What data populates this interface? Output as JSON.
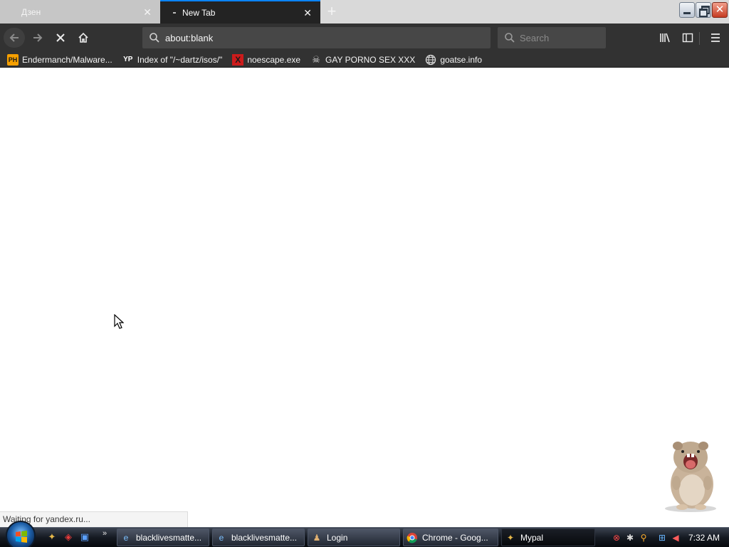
{
  "tabs": [
    {
      "title": "Дзен",
      "close": "✕"
    },
    {
      "title": "New Tab",
      "close": "✕"
    }
  ],
  "newtab_symbol": "+",
  "window_controls": {
    "minimize": "",
    "maximize": "",
    "close": "✕"
  },
  "nav": {
    "back_icon": "arrow-left-icon",
    "forward_icon": "arrow-right-icon",
    "stop_icon": "stop-icon",
    "home_icon": "home-icon",
    "url": "about:blank",
    "search_placeholder": "Search"
  },
  "bookmarks": [
    {
      "label": "Endermanch/Malware...",
      "icon": "PH"
    },
    {
      "label": "Index of \"/~dartz/isos/\"",
      "icon": "YP"
    },
    {
      "label": "noescape.exe",
      "icon": "X"
    },
    {
      "label": "GAY PORNO SEX XXX",
      "icon": "skull-icon"
    },
    {
      "label": "goatse.info",
      "icon": "globe-icon"
    }
  ],
  "status": "Waiting for yandex.ru...",
  "taskbar": {
    "buttons": [
      {
        "label": "blacklivesmatte...",
        "icon": "ie-icon"
      },
      {
        "label": "blacklivesmatte...",
        "icon": "ie-icon"
      },
      {
        "label": "Login",
        "icon": "app-icon"
      },
      {
        "label": "Chrome - Goog...",
        "icon": "chrome-icon"
      },
      {
        "label": "Mypal",
        "icon": "mypal-icon"
      }
    ],
    "more": "»",
    "clock": "7:32 AM"
  },
  "colors": {
    "accent": "#0a84ff",
    "toolbar": "#323232",
    "tab_active": "#232323"
  }
}
